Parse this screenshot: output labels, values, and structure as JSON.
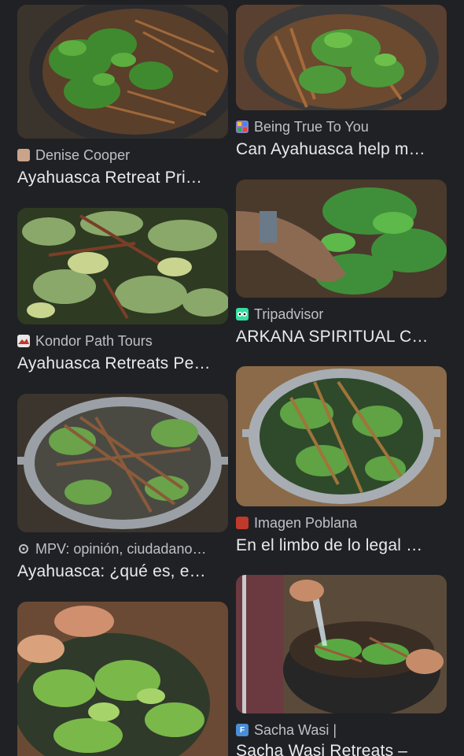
{
  "results": {
    "left": [
      {
        "source": "Denise Cooper",
        "title": "Ayahuasca Retreat Pri…",
        "favicon": "portrait-favicon-icon"
      },
      {
        "source": "Kondor Path Tours",
        "title": "Ayahuasca Retreats Pe…",
        "favicon": "mountain-favicon-icon"
      },
      {
        "source": "MPV: opinión, ciudadano…",
        "title": "Ayahuasca: ¿qué es, e…",
        "favicon": "circle-favicon-icon"
      },
      {
        "source": "",
        "title": "",
        "favicon": ""
      }
    ],
    "right": [
      {
        "source": "Being True To You",
        "title": "Can Ayahuasca help m…",
        "favicon": "grid-favicon-icon"
      },
      {
        "source": "Tripadvisor",
        "title": "ARKANA SPIRITUAL C…",
        "favicon": "owl-favicon-icon"
      },
      {
        "source": "Imagen Poblana",
        "title": "En el limbo de lo legal …",
        "favicon": "red-square-favicon-icon"
      },
      {
        "source": "Sacha Wasi |",
        "title": "Sacha Wasi Retreats –",
        "favicon": "letter-f-favicon-icon",
        "favicon_letter": "F"
      }
    ]
  },
  "colors": {
    "background": "#202124",
    "source_text": "#bdc1c6",
    "title_text": "#e8eaed"
  }
}
